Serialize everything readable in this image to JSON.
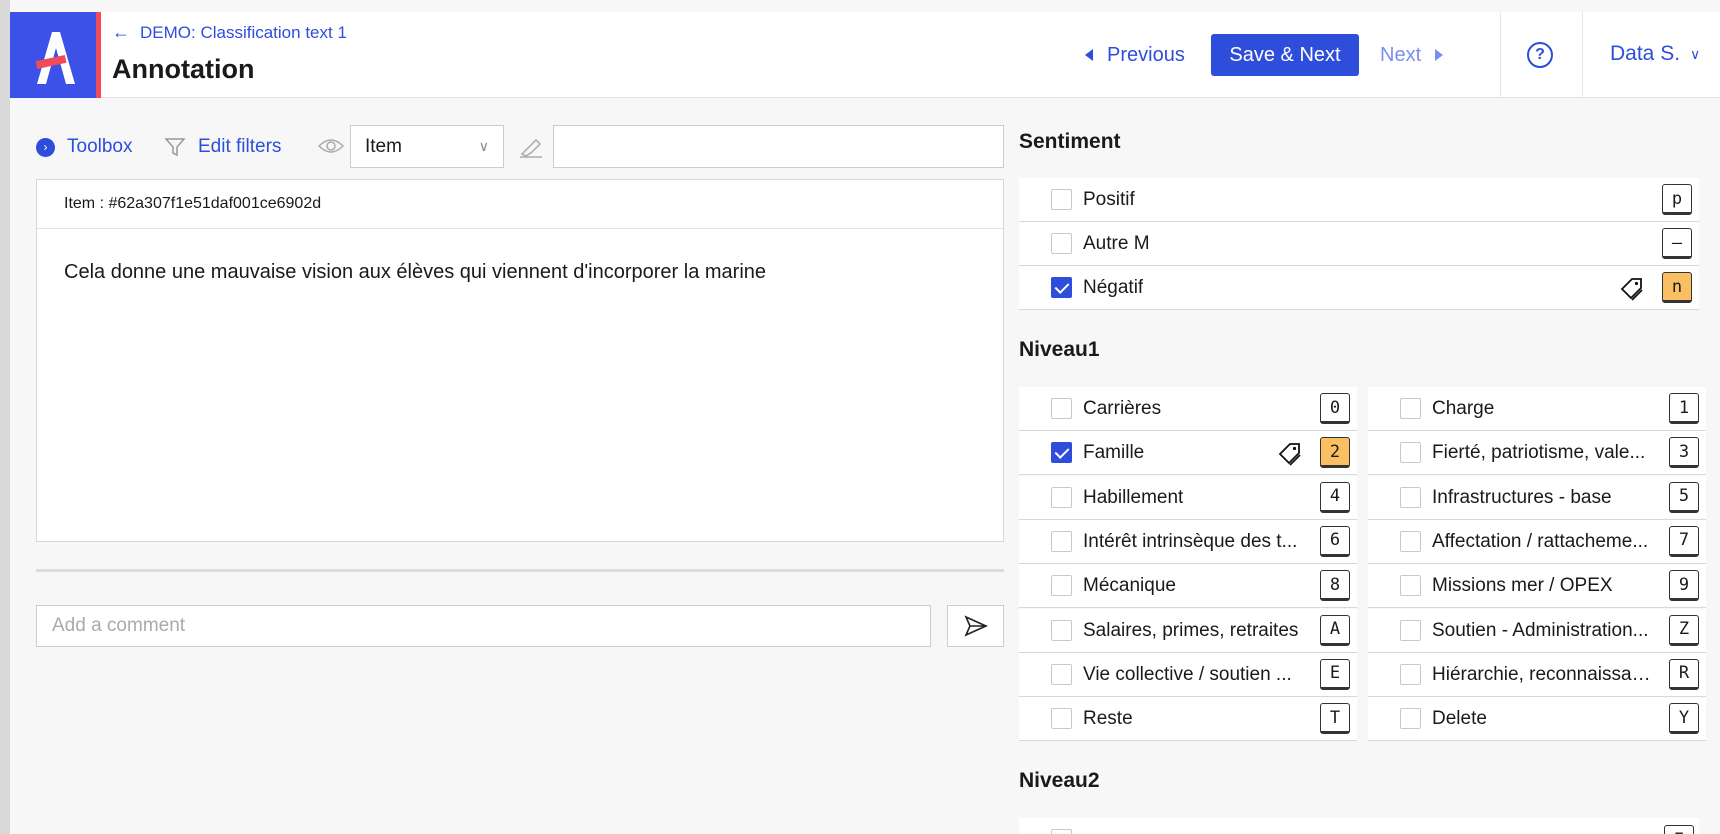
{
  "header": {
    "breadcrumb": "DEMO: Classification text 1",
    "title": "Annotation",
    "previous_label": "Previous",
    "save_next_label": "Save & Next",
    "next_label": "Next",
    "help_label": "?",
    "user_label": "Data S."
  },
  "toolbar": {
    "toolbox_label": "Toolbox",
    "edit_filters_label": "Edit filters",
    "view_select_value": "Item",
    "highlight_input_value": ""
  },
  "item": {
    "id_label": "Item : #62a307f1e51daf001ce6902d",
    "text": "Cela donne une mauvaise vision aux élèves qui viennent d'incorporer la marine"
  },
  "comment": {
    "placeholder": "Add a comment"
  },
  "sentiment": {
    "title": "Sentiment",
    "options": [
      {
        "label": "Positif",
        "key": "p",
        "checked": false
      },
      {
        "label": "Autre M",
        "key": "–",
        "checked": false
      },
      {
        "label": "Négatif",
        "key": "n",
        "checked": true
      }
    ]
  },
  "niveau1": {
    "title": "Niveau1",
    "options": [
      {
        "label": "Carrières",
        "key": "0",
        "checked": false
      },
      {
        "label": "Charge",
        "key": "1",
        "checked": false
      },
      {
        "label": "Famille",
        "key": "2",
        "checked": true
      },
      {
        "label": "Fierté, patriotisme, vale...",
        "key": "3",
        "checked": false
      },
      {
        "label": "Habillement",
        "key": "4",
        "checked": false
      },
      {
        "label": "Infrastructures - base",
        "key": "5",
        "checked": false
      },
      {
        "label": "Intérêt intrinsèque des t...",
        "key": "6",
        "checked": false
      },
      {
        "label": "Affectation / rattacheme...",
        "key": "7",
        "checked": false
      },
      {
        "label": "Mécanique",
        "key": "8",
        "checked": false
      },
      {
        "label": "Missions mer / OPEX",
        "key": "9",
        "checked": false
      },
      {
        "label": "Salaires, primes, retraites",
        "key": "A",
        "checked": false
      },
      {
        "label": "Soutien - Administration...",
        "key": "Z",
        "checked": false
      },
      {
        "label": "Vie collective / soutien ...",
        "key": "E",
        "checked": false
      },
      {
        "label": "Hiérarchie, reconnaissan...",
        "key": "R",
        "checked": false
      },
      {
        "label": "Reste",
        "key": "T",
        "checked": false
      },
      {
        "label": "Delete",
        "key": "Y",
        "checked": false
      }
    ]
  },
  "niveau2": {
    "title": "Niveau2",
    "first_key": "E"
  },
  "colors": {
    "accent": "#2f4ddb",
    "logo_bg": "#3b51e8",
    "logo_stripe": "#f04a5b",
    "selected_key": "#fbbf63"
  },
  "icons": {
    "back": "arrow-left-icon",
    "help": "help-circle-icon",
    "toolbox": "chevron-circle-icon",
    "filters": "filter-icon",
    "visibility": "eye-icon",
    "highlight": "highlighter-icon",
    "send": "send-icon",
    "tag": "tag-icon"
  }
}
